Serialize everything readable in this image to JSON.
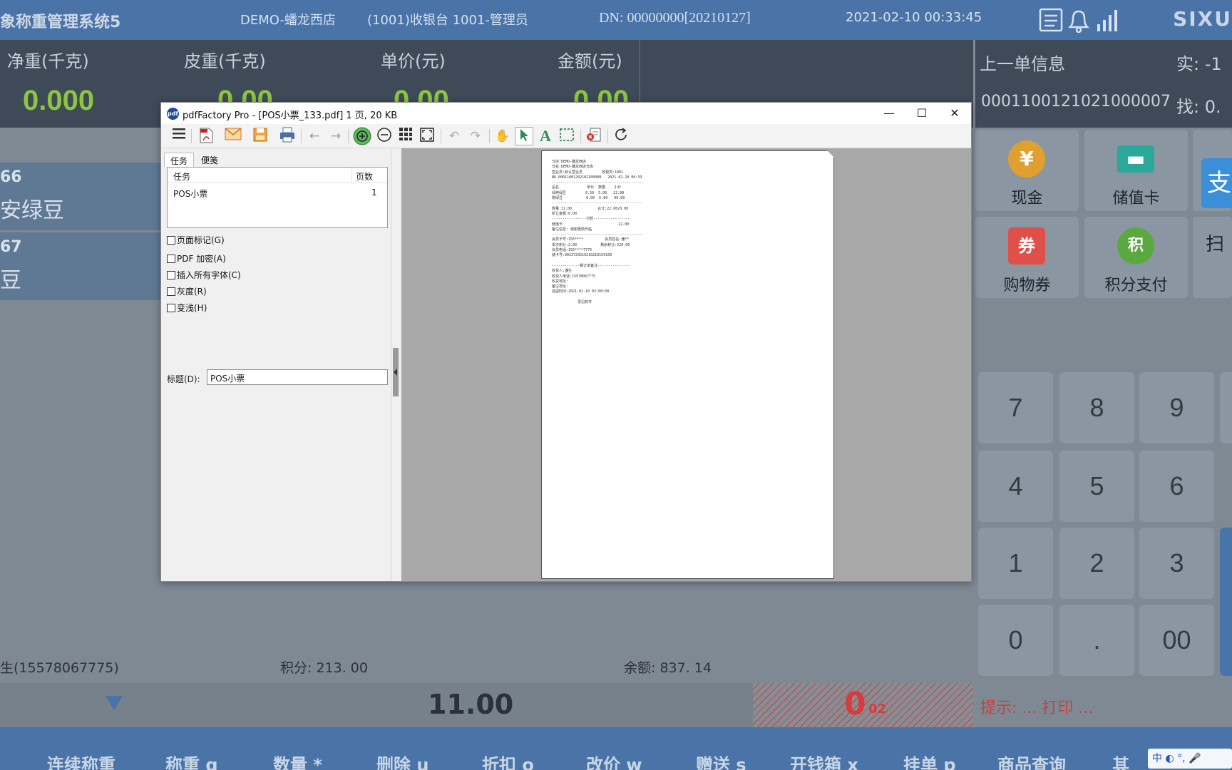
{
  "pos": {
    "app_title": "象称重管理系统5",
    "store": "DEMO-蟠龙西店",
    "register": "(1001)收银台 1001-管理员",
    "dn": "DN: 00000000[20210127]",
    "datetime": "2021-02-10 00:33:45",
    "brand": "SIXU",
    "scale": {
      "net_label": "净重(千克)",
      "net_value": "0.000",
      "tare_label": "皮重(千克)",
      "tare_value": "0.00",
      "price_label": "单价(元)",
      "price_value": "0.00",
      "amount_label": "金额(元)",
      "amount_value": "0.00"
    },
    "last_order": {
      "title": "上一单信息",
      "paid": "实: -1",
      "order_no": "0001100121021000007",
      "change": "找: 0."
    },
    "items": [
      {
        "no": "66",
        "name": "安绿豆"
      },
      {
        "no": "67",
        "name": "豆"
      }
    ],
    "member": {
      "name": "生(15578067775)",
      "points": "积分: 213. 00",
      "balance": "余额: 837. 14"
    },
    "total_qty": "11.00",
    "total_due_big": "0",
    "total_due_small": "02",
    "payments": [
      {
        "label": "现金",
        "icon": "¥",
        "color": "#e0a030"
      },
      {
        "label": "储值卡",
        "icon": "▬",
        "color": "#2aa89a"
      },
      {
        "label": "购物券",
        "icon": "券",
        "color": "#e0504a"
      },
      {
        "label": "积分支付",
        "icon": "积",
        "color": "#5aa840"
      }
    ],
    "scan_label": "扫",
    "alipay_label": "支",
    "keys": [
      "7",
      "8",
      "9",
      "4",
      "5",
      "6",
      "1",
      "2",
      "3",
      "0",
      ".",
      "00"
    ],
    "hint": "提示: ... 打印 ...",
    "function_keys": [
      "连续称重",
      "称重 q",
      "数量 *",
      "删除 u",
      "折扣 o",
      "改价 w",
      "赠送 s",
      "开钱箱 x",
      "挂单 p",
      "商品查询",
      "其"
    ],
    "ime": "中 ◐ °, 🎤"
  },
  "pdf": {
    "logo": "pdf",
    "window_title": "pdfFactory Pro - [POS小票_133.pdf] 1 页, 20 KB",
    "controls": {
      "minimize": "—",
      "maximize": "☐",
      "close": "✕"
    },
    "toolbar_icons": [
      "menu-icon",
      "pdf-icon",
      "email-icon",
      "save-icon",
      "print-icon",
      "back-icon",
      "forward-icon",
      "zoom-in-icon",
      "zoom-out-icon",
      "grid-icon",
      "fit-icon",
      "undo-icon",
      "redo-icon",
      "hand-icon",
      "select-icon",
      "text-icon",
      "marquee-icon",
      "delete-icon",
      "refresh-icon"
    ],
    "tabs": [
      "任务",
      "便笺"
    ],
    "task_header": {
      "task": "任务",
      "pages": "页数"
    },
    "tasks": [
      {
        "name": "POS小票",
        "pages": "1"
      }
    ],
    "options": [
      "页面标记(G)",
      "PDF 加密(A)",
      "插入所有字体(C)",
      "灰度(R)",
      "变浅(H)"
    ],
    "title_label": "标题(D):",
    "title_value": "POS小票",
    "receipt_lines": [
      "分店:DEMO-蟠龙西店",
      "仓名:DEMO-蟠龙西店仓库",
      "营业员:默认营业员         收银员:1001",
      "NO.00011001202102100008   2021-02-10 00:33",
      "------------------------------------------",
      "品名             单价  数量    小计",
      "绿壳绿豆         0.50  5.00   22.00",
      "赠绿豆           0.00  6.00   00.00",
      "------------------------------------------",
      "数量:11.00            合计:22.00/0.00",
      "折让金额:0.00",
      "----------------付款-----------------",
      "储值卡                          22.00",
      "备注信息: 谢谢惠顾光临",
      "------------------------------------------",
      "会员卡号:155****          会员姓名:潘**",
      "本次积分:2.00           剩余积分:220.00",
      "会员电话:155****7775",
      "储卡号:9023720210210210150100",
      "",
      "-------------餐订单备注---------------",
      "收货人:潘生",
      "收货人电话:15578067775",
      "收货地址:",
      "备注地址:",
      "自提时间:2021-02-10 02:00:00",
      "",
      "            思迅软件"
    ]
  }
}
